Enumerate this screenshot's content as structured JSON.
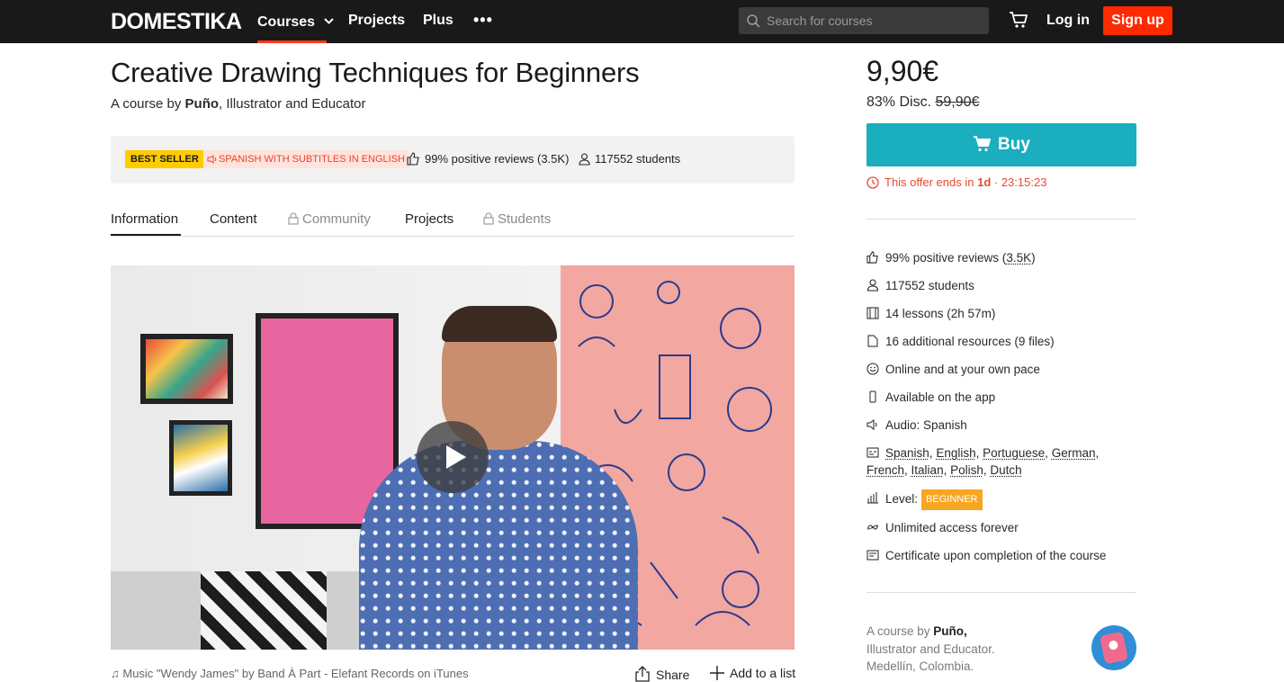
{
  "nav": {
    "logo": "DOMESTIKA",
    "courses_label": "Courses",
    "projects_label": "Projects",
    "plus_label": "Plus",
    "more_label": "•••",
    "search_placeholder": "Search for courses",
    "login_label": "Log in",
    "signup_label": "Sign up",
    "accent_color": "#ff2a00"
  },
  "course": {
    "title": "Creative Drawing Techniques for Beginners",
    "byline_prefix": "A course by ",
    "author_name": "Puño",
    "byline_suffix": ", Illustrator and Educator",
    "best_seller": "BEST SELLER",
    "language_badge": "SPANISH WITH SUBTITLES IN ENGLISH",
    "reviews": "99% positive reviews (3.5K)",
    "students": "117552 students"
  },
  "tabs": [
    {
      "label": "Information",
      "active": true,
      "locked": false
    },
    {
      "label": "Content",
      "active": false,
      "locked": false
    },
    {
      "label": "Community",
      "active": false,
      "locked": true
    },
    {
      "label": "Projects",
      "active": false,
      "locked": false
    },
    {
      "label": "Students",
      "active": false,
      "locked": true
    }
  ],
  "video": {
    "credit": "♫ Music \"Wendy James\" by Band À Part - Elefant Records on iTunes",
    "share_label": "Share",
    "add_list_label": "Add to a list"
  },
  "purchase": {
    "price": "9,90€",
    "discount_text": "83% Disc. ",
    "original_price": "59,90€",
    "buy_label": "Buy",
    "buy_color": "#1aaebf",
    "offer_prefix": "This offer ends in ",
    "offer_days": "1d",
    "offer_sep": " · ",
    "offer_time": "23:15:23"
  },
  "features": {
    "reviews_prefix": "99% positive reviews (",
    "reviews_count": "3.5K",
    "reviews_suffix": ")",
    "students": "117552 students",
    "lessons": "14 lessons (2h 57m)",
    "resources": "16 additional resources (9 files)",
    "pace": "Online and at your own pace",
    "app": "Available on the app",
    "audio": "Audio: Spanish",
    "subtitles": [
      "Spanish",
      "English",
      "Portuguese",
      "German",
      "French",
      "Italian",
      "Polish",
      "Dutch"
    ],
    "level_label": "Level:",
    "level_value": "BEGINNER",
    "access": "Unlimited access forever",
    "certificate": "Certificate upon completion of the course"
  },
  "author_box": {
    "prefix": "A course by ",
    "name": "Puño,",
    "line2": "Illustrator and Educator.",
    "line3": "Medellín, Colombia."
  }
}
